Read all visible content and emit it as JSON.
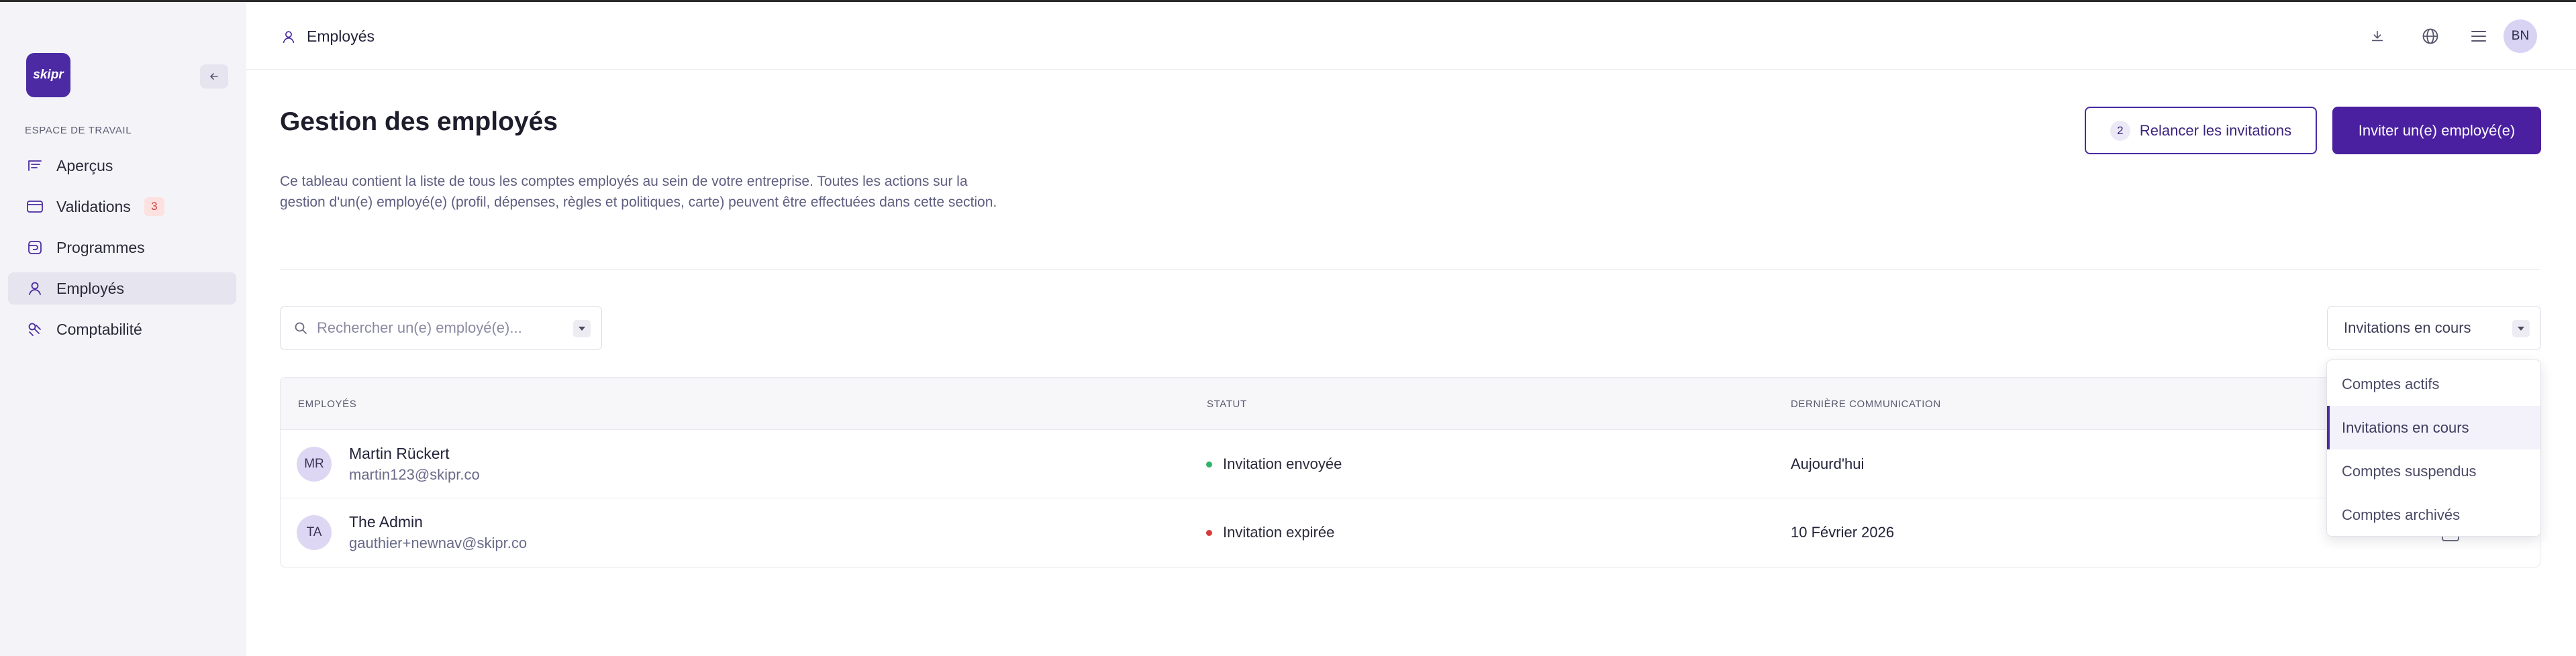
{
  "sidebar": {
    "logo_text": "skipr",
    "section_label": "ESPACE DE TRAVAIL",
    "items": [
      {
        "label": "Aperçus",
        "icon": "chart-lines-icon"
      },
      {
        "label": "Validations",
        "icon": "card-icon",
        "badge": "3"
      },
      {
        "label": "Programmes",
        "icon": "wallet-icon"
      },
      {
        "label": "Employés",
        "icon": "user-icon",
        "active": true
      },
      {
        "label": "Comptabilité",
        "icon": "coins-icon"
      }
    ]
  },
  "header": {
    "breadcrumb": "Employés",
    "avatar_initials": "BN"
  },
  "main": {
    "title": "Gestion des employés",
    "description": "Ce tableau contient la liste de tous les comptes employés au sein de votre entreprise. Toutes les actions sur la gestion d'un(e) employé(e) (profil, dépenses, règles et politiques, carte) peuvent être effectuées dans cette section.",
    "resend_button": {
      "count": "2",
      "label": "Relancer les invitations"
    },
    "invite_button": "Inviter un(e) employé(e)",
    "search_placeholder": "Rechercher un(e) employé(e)...",
    "filter_value": "Invitations en cours",
    "filter_options": [
      "Comptes actifs",
      "Invitations en cours",
      "Comptes suspendus",
      "Comptes archivés"
    ],
    "table": {
      "headers": [
        "EMPLOYÉS",
        "STATUT",
        "DERNIÈRE COMMUNICATION"
      ],
      "rows": [
        {
          "initials": "MR",
          "name": "Martin Rückert",
          "email": "martin123@skipr.co",
          "status": "Invitation envoyée",
          "status_color": "#2fb36a",
          "last": "Aujourd'hui"
        },
        {
          "initials": "TA",
          "name": "The Admin",
          "email": "gauthier+newnav@skipr.co",
          "status": "Invitation expirée",
          "status_color": "#d93a3a",
          "last": "10 Février 2026"
        }
      ]
    }
  },
  "colors": {
    "accent": "#4a1fa0",
    "sidebar_bg": "#f4f4f8"
  }
}
